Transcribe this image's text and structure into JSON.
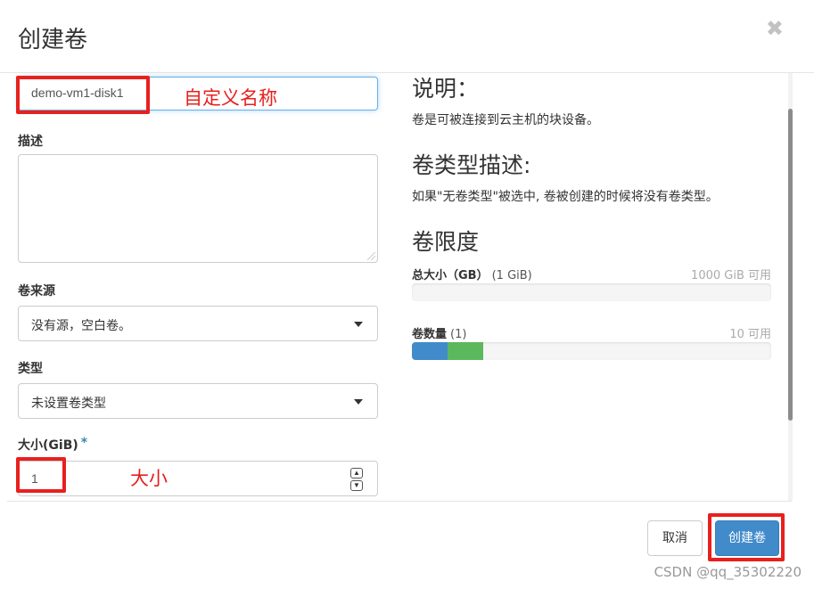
{
  "modal": {
    "title": "创建卷",
    "close_glyph": "✖"
  },
  "form": {
    "name_value": "demo-vm1-disk1",
    "description_label": "描述",
    "description_value": "",
    "source_label": "卷来源",
    "source_selected": "没有源，空白卷。",
    "type_label": "类型",
    "type_selected": "未设置卷类型",
    "size_label": "大小(GiB)",
    "size_required_mark": "*",
    "size_value": "1"
  },
  "annotations": {
    "name_note": "自定义名称",
    "size_note": "大小"
  },
  "help": {
    "description_heading": "说明：",
    "description_text": "卷是可被连接到云主机的块设备。",
    "volume_type_heading": "卷类型描述:",
    "volume_type_text": "如果\"无卷类型\"被选中, 卷被创建的时候将没有卷类型。",
    "limits_heading": "卷限度"
  },
  "quotas": {
    "total_size": {
      "label": "总大小（GB）",
      "used": "(1 GiB)",
      "available": "1000 GiB 可用",
      "fill_fraction": 0.001
    },
    "volume_count": {
      "label": "卷数量",
      "used": "(1)",
      "available": "10 可用",
      "used_fraction": 0.1,
      "new_fraction": 0.1
    }
  },
  "footer": {
    "cancel_label": "取消",
    "create_label": "创建卷"
  },
  "watermark": "CSDN @qq_35302220",
  "colors": {
    "primary": "#428bca",
    "progress_blue": "#428bca",
    "progress_green": "#5cb85c",
    "annotation_red": "#e8201e"
  },
  "icons": {
    "close": "close-icon",
    "caret": "chevron-down-icon",
    "stepper_up": "chevron-up-icon",
    "stepper_down": "chevron-down-icon"
  }
}
